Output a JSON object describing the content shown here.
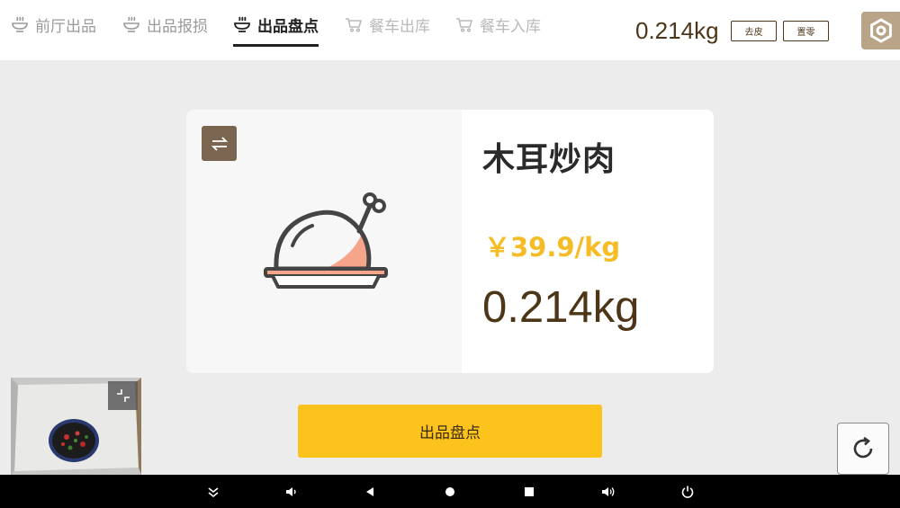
{
  "tabs": [
    {
      "label": "前厅出品",
      "icon": "bowl-icon"
    },
    {
      "label": "出品报损",
      "icon": "bowl-icon"
    },
    {
      "label": "出品盘点",
      "icon": "bowl-icon",
      "active": true
    },
    {
      "label": "餐车出库",
      "icon": "cart-icon"
    },
    {
      "label": "餐车入库",
      "icon": "cart-icon"
    }
  ],
  "scale": {
    "weight": "0.214kg",
    "tare_label": "去皮",
    "zero_label": "置零"
  },
  "product": {
    "name": "木耳炒肉",
    "price": "￥39.9/kg",
    "weight": "0.214kg",
    "image_icon": "roast-chicken-icon"
  },
  "action": {
    "label": "出品盘点"
  },
  "colors": {
    "accent_yellow": "#fbc31c",
    "brown": "#4d3518",
    "price_yellow": "#f5bc25",
    "settings_bg": "#b9a488",
    "swap_bg": "#7a6650"
  }
}
